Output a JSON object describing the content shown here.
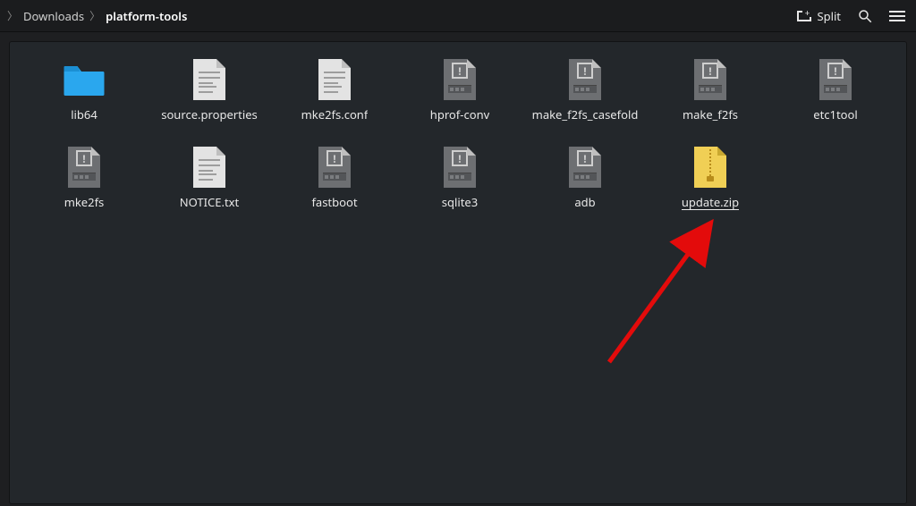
{
  "toolbar": {
    "breadcrumb": [
      {
        "label": "Downloads",
        "active": false
      },
      {
        "label": "platform-tools",
        "active": true
      }
    ],
    "split_label": "Split"
  },
  "files": [
    {
      "name": "lib64",
      "type": "folder"
    },
    {
      "name": "source.properties",
      "type": "text"
    },
    {
      "name": "mke2fs.conf",
      "type": "text"
    },
    {
      "name": "hprof-conv",
      "type": "exec"
    },
    {
      "name": "make_f2fs_casefold",
      "type": "exec"
    },
    {
      "name": "make_f2fs",
      "type": "exec"
    },
    {
      "name": "etc1tool",
      "type": "exec"
    },
    {
      "name": "mke2fs",
      "type": "exec"
    },
    {
      "name": "NOTICE.txt",
      "type": "text"
    },
    {
      "name": "fastboot",
      "type": "exec"
    },
    {
      "name": "sqlite3",
      "type": "exec"
    },
    {
      "name": "adb",
      "type": "exec"
    },
    {
      "name": "update.zip",
      "type": "zip",
      "selected": true
    }
  ]
}
